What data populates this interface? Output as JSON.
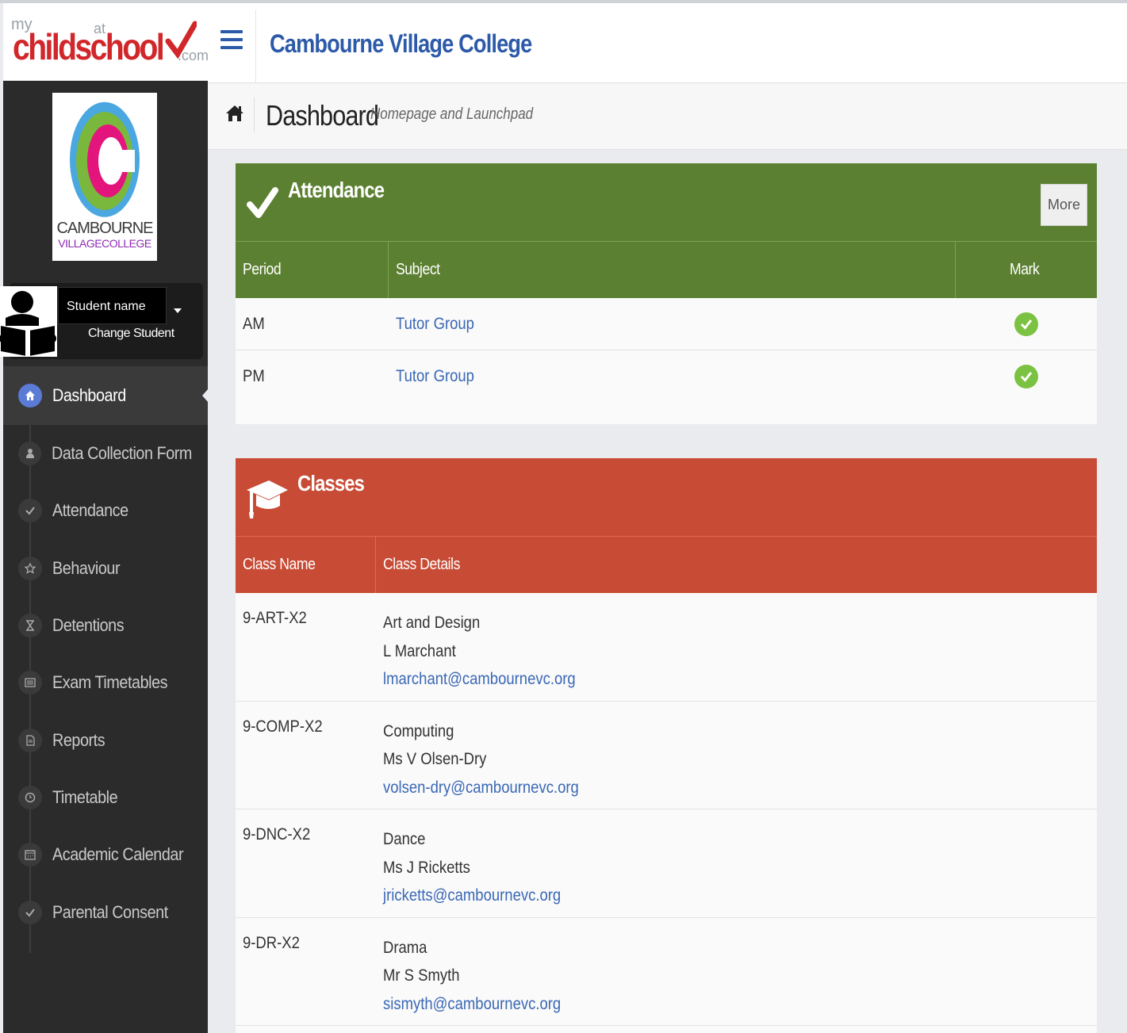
{
  "brand": {
    "logo_text_my": "my",
    "logo_text_child": "childschool",
    "logo_text_at": "at",
    "logo_text_com": ".com",
    "accent": "#d1262a"
  },
  "school_logo": {
    "name": "CAMBOURNE",
    "sub": "VILLAGECOLLEGE"
  },
  "student": {
    "name": "Student name",
    "change_label": "Change Student"
  },
  "header": {
    "title": "Cambourne Village College"
  },
  "breadcrumb": {
    "title": "Dashboard",
    "subtitle": "Homepage and Launchpad"
  },
  "sidebar": {
    "items": [
      {
        "label": "Dashboard",
        "icon": "home-icon",
        "active": true
      },
      {
        "label": "Data Collection Form",
        "icon": "user-icon"
      },
      {
        "label": "Attendance",
        "icon": "check-icon"
      },
      {
        "label": "Behaviour",
        "icon": "star-icon"
      },
      {
        "label": "Detentions",
        "icon": "hourglass-icon"
      },
      {
        "label": "Exam Timetables",
        "icon": "list-icon"
      },
      {
        "label": "Reports",
        "icon": "document-icon"
      },
      {
        "label": "Timetable",
        "icon": "clock-icon"
      },
      {
        "label": "Academic Calendar",
        "icon": "calendar-icon"
      },
      {
        "label": "Parental Consent",
        "icon": "check-icon"
      }
    ]
  },
  "attendance": {
    "title": "Attendance",
    "more_label": "More",
    "color": "#5c8031",
    "columns": [
      "Period",
      "Subject",
      "Mark"
    ],
    "rows": [
      {
        "period": "AM",
        "subject": "Tutor Group",
        "mark": "present"
      },
      {
        "period": "PM",
        "subject": "Tutor Group",
        "mark": "present"
      }
    ]
  },
  "classes": {
    "title": "Classes",
    "color": "#c84b35",
    "columns": [
      "Class Name",
      "Class Details"
    ],
    "rows": [
      {
        "name": "9-ART-X2",
        "subject": "Art and Design",
        "teacher": "L Marchant",
        "email": "lmarchant@cambournevc.org"
      },
      {
        "name": "9-COMP-X2",
        "subject": "Computing",
        "teacher": "Ms V Olsen-Dry",
        "email": "volsen-dry@cambournevc.org"
      },
      {
        "name": "9-DNC-X2",
        "subject": "Dance",
        "teacher": "Ms J Ricketts",
        "email": "jricketts@cambournevc.org"
      },
      {
        "name": "9-DR-X2",
        "subject": "Drama",
        "teacher": "Mr S Smyth",
        "email": "sismyth@cambournevc.org"
      }
    ]
  }
}
